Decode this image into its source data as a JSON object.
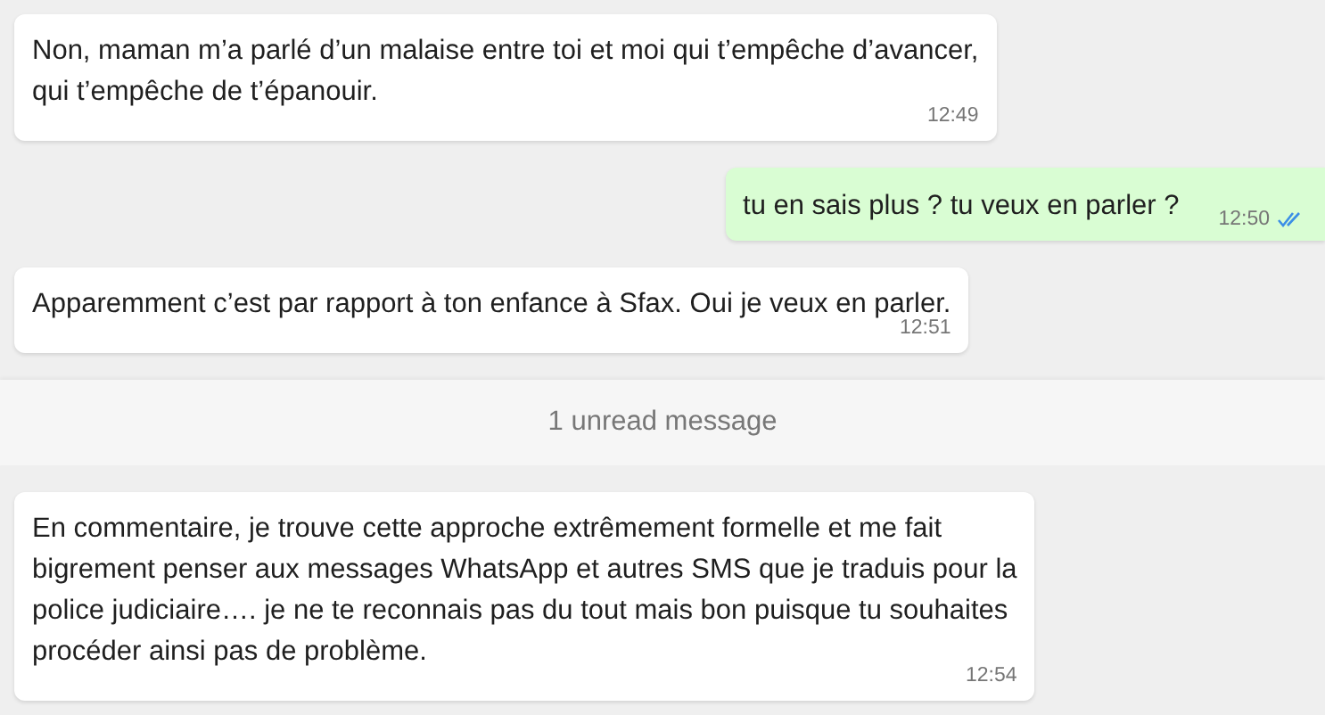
{
  "messages": [
    {
      "kind": "message",
      "outgoing": false,
      "lines": [
        "Non, maman m’a parlé d’un malaise entre toi et moi qui t’empêche d’avancer,",
        "qui t’empêche de t’épanouir."
      ],
      "time": "12:49"
    },
    {
      "kind": "message",
      "outgoing": true,
      "lines": [
        "tu en sais plus ? tu veux en parler ?"
      ],
      "time": "12:50",
      "read": true
    },
    {
      "kind": "message",
      "outgoing": false,
      "lines": [
        "Apparemment c’est par rapport à ton enfance à Sfax. Oui je veux en parler."
      ],
      "time": "12:51"
    },
    {
      "kind": "divider",
      "text": "1 unread message"
    },
    {
      "kind": "message",
      "outgoing": false,
      "lines": [
        "En commentaire, je trouve cette approche extrêmement formelle et me fait",
        "bigrement penser aux messages WhatsApp et autres SMS que je traduis pour la",
        "police judiciaire…. je ne te reconnais pas du tout mais bon puisque tu souhaites",
        "procéder ainsi pas de problème."
      ],
      "time": "12:54"
    }
  ]
}
